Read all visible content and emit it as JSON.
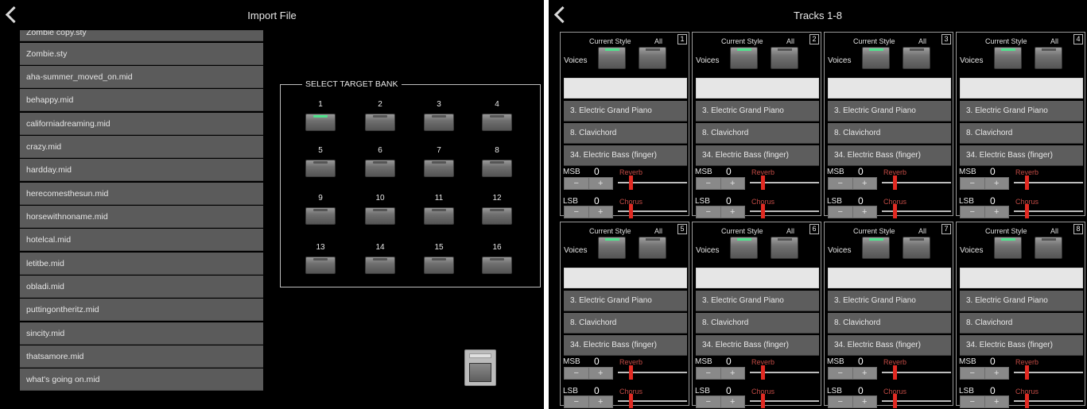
{
  "import_panel": {
    "title": "Import File",
    "files": [
      "Zombie copy.sty",
      "Zombie.sty",
      "aha-summer_moved_on.mid",
      "behappy.mid",
      "californiadreaming.mid",
      "crazy.mid",
      "hardday.mid",
      "herecomesthesun.mid",
      "horsewithnoname.mid",
      "hotelcal.mid",
      "letitbe.mid",
      "obladi.mid",
      "puttingontheritz.mid",
      "sincity.mid",
      "thatsamore.mid",
      "what's going on.mid"
    ],
    "target_bank": {
      "legend": "SELECT TARGET BANK",
      "banks": [
        "1",
        "2",
        "3",
        "4",
        "5",
        "6",
        "7",
        "8",
        "9",
        "10",
        "11",
        "12",
        "13",
        "14",
        "15",
        "16"
      ],
      "selected": "1",
      "active_color": "#4fe28c"
    }
  },
  "tracks_panel": {
    "title": "Tracks 1-8",
    "tracks": [
      {
        "num": "1",
        "style_label": "Current Style",
        "all_label": "All",
        "voices_label": "Voices",
        "voices": [
          "3. Electric Grand Piano",
          "8. Clavichord",
          "34. Electric Bass (finger)"
        ],
        "msb_label": "MSB",
        "msb": "0",
        "lsb_label": "LSB",
        "lsb": "0",
        "reverb_label": "Reverb",
        "chorus_label": "Chorus",
        "minus": "−",
        "plus": "+"
      },
      {
        "num": "2",
        "style_label": "Current Style",
        "all_label": "All",
        "voices_label": "Voices",
        "voices": [
          "3. Electric Grand Piano",
          "8. Clavichord",
          "34. Electric Bass (finger)"
        ],
        "msb_label": "MSB",
        "msb": "0",
        "lsb_label": "LSB",
        "lsb": "0",
        "reverb_label": "Reverb",
        "chorus_label": "Chorus",
        "minus": "−",
        "plus": "+"
      },
      {
        "num": "3",
        "style_label": "Current Style",
        "all_label": "All",
        "voices_label": "Voices",
        "voices": [
          "3. Electric Grand Piano",
          "8. Clavichord",
          "34. Electric Bass (finger)"
        ],
        "msb_label": "MSB",
        "msb": "0",
        "lsb_label": "LSB",
        "lsb": "0",
        "reverb_label": "Reverb",
        "chorus_label": "Chorus",
        "minus": "−",
        "plus": "+"
      },
      {
        "num": "4",
        "style_label": "Current Style",
        "all_label": "All",
        "voices_label": "Voices",
        "voices": [
          "3. Electric Grand Piano",
          "8. Clavichord",
          "34. Electric Bass (finger)"
        ],
        "msb_label": "MSB",
        "msb": "0",
        "lsb_label": "LSB",
        "lsb": "0",
        "reverb_label": "Reverb",
        "chorus_label": "Chorus",
        "minus": "−",
        "plus": "+"
      },
      {
        "num": "5",
        "style_label": "Current Style",
        "all_label": "All",
        "voices_label": "Voices",
        "voices": [
          "3. Electric Grand Piano",
          "8. Clavichord",
          "34. Electric Bass (finger)"
        ],
        "msb_label": "MSB",
        "msb": "0",
        "lsb_label": "LSB",
        "lsb": "0",
        "reverb_label": "Reverb",
        "chorus_label": "Chorus",
        "minus": "−",
        "plus": "+"
      },
      {
        "num": "6",
        "style_label": "Current Style",
        "all_label": "All",
        "voices_label": "Voices",
        "voices": [
          "3. Electric Grand Piano",
          "8. Clavichord",
          "34. Electric Bass (finger)"
        ],
        "msb_label": "MSB",
        "msb": "0",
        "lsb_label": "LSB",
        "lsb": "0",
        "reverb_label": "Reverb",
        "chorus_label": "Chorus",
        "minus": "−",
        "plus": "+"
      },
      {
        "num": "7",
        "style_label": "Current Style",
        "all_label": "All",
        "voices_label": "Voices",
        "voices": [
          "3. Electric Grand Piano",
          "8. Clavichord",
          "34. Electric Bass (finger)"
        ],
        "msb_label": "MSB",
        "msb": "0",
        "lsb_label": "LSB",
        "lsb": "0",
        "reverb_label": "Reverb",
        "chorus_label": "Chorus",
        "minus": "−",
        "plus": "+"
      },
      {
        "num": "8",
        "style_label": "Current Style",
        "all_label": "All",
        "voices_label": "Voices",
        "voices": [
          "3. Electric Grand Piano",
          "8. Clavichord",
          "34. Electric Bass (finger)"
        ],
        "msb_label": "MSB",
        "msb": "0",
        "lsb_label": "LSB",
        "lsb": "0",
        "reverb_label": "Reverb",
        "chorus_label": "Chorus",
        "minus": "−",
        "plus": "+"
      }
    ],
    "current_style_selected": true,
    "reverb_color": "#c24b45",
    "slider_color": "#e22a22"
  },
  "icons": {
    "back": "chevron-left-icon"
  }
}
